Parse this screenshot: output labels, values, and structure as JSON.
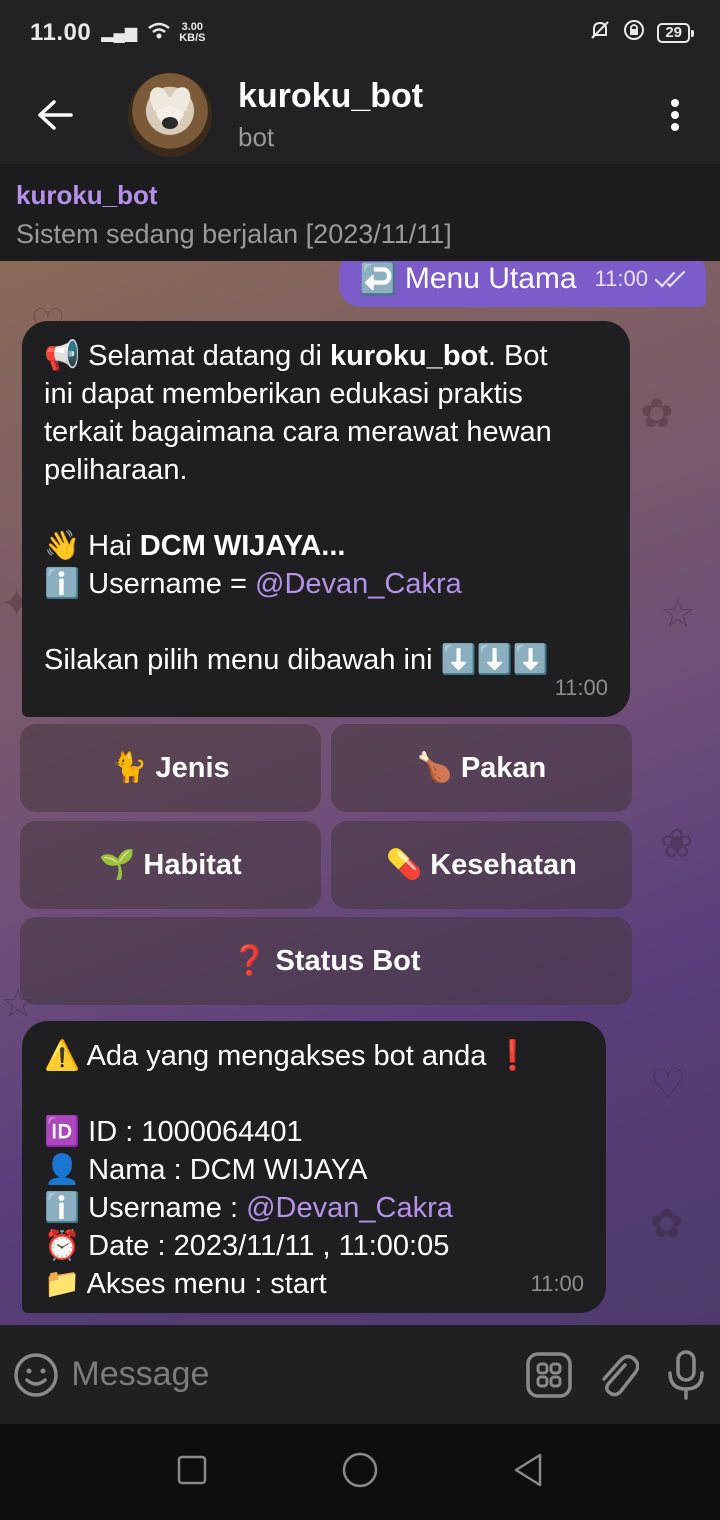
{
  "status_bar": {
    "time": "11.00",
    "net_speed_value": "3.00",
    "net_speed_unit": "KB/S",
    "battery": "29"
  },
  "header": {
    "title": "kuroku_bot",
    "subtitle": "bot"
  },
  "pinned": {
    "title": "kuroku_bot",
    "text": "Sistem sedang berjalan [2023/11/11]"
  },
  "outgoing": {
    "emoji": "↩️",
    "text": "Menu Utama",
    "time": "11:00"
  },
  "welcome": {
    "l1_emoji": "📢",
    "l1_a": " Selamat datang di ",
    "l1_bold": "kuroku_bot",
    "l1_b": ". Bot",
    "l2": "ini dapat memberikan edukasi praktis",
    "l3": "terkait bagaimana cara merawat hewan",
    "l4": "peliharaan.",
    "hai_emoji": "👋",
    "hai_text": " Hai ",
    "hai_name": "DCM WIJAYA...",
    "user_emoji": "ℹ️",
    "user_label": " Username = ",
    "user_mention": "@Devan_Cakra",
    "choose_text": "Silakan pilih menu dibawah ini ",
    "choose_emoji": "⬇️⬇️⬇️",
    "time": "11:00"
  },
  "keyboard": [
    {
      "emoji": "🐈",
      "label": "Jenis"
    },
    {
      "emoji": "🍗",
      "label": "Pakan"
    },
    {
      "emoji": "🌱",
      "label": "Habitat"
    },
    {
      "emoji": "💊",
      "label": "Kesehatan"
    },
    {
      "emoji": "❓",
      "label": "Status Bot"
    }
  ],
  "alert": {
    "title_emoji": "⚠️",
    "title": " Ada yang mengakses bot anda ",
    "title_emoji2": "❗",
    "id_emoji": "🆔",
    "id": " ID : 1000064401",
    "nama_emoji": "👤",
    "nama": " Nama : DCM WIJAYA",
    "user_emoji": "ℹ️",
    "user_label": " Username : ",
    "user_mention": "@Devan_Cakra",
    "date_emoji": "⏰",
    "date": " Date : 2023/11/11 , 11:00:05",
    "akses_emoji": "📁",
    "akses": " Akses menu : start",
    "time": "11:00"
  },
  "input": {
    "placeholder": "Message"
  },
  "colors": {
    "accent": "#b592ea",
    "out_bubble": "#7b5cc9",
    "in_bubble": "#1f1f21",
    "bar": "#222224"
  }
}
